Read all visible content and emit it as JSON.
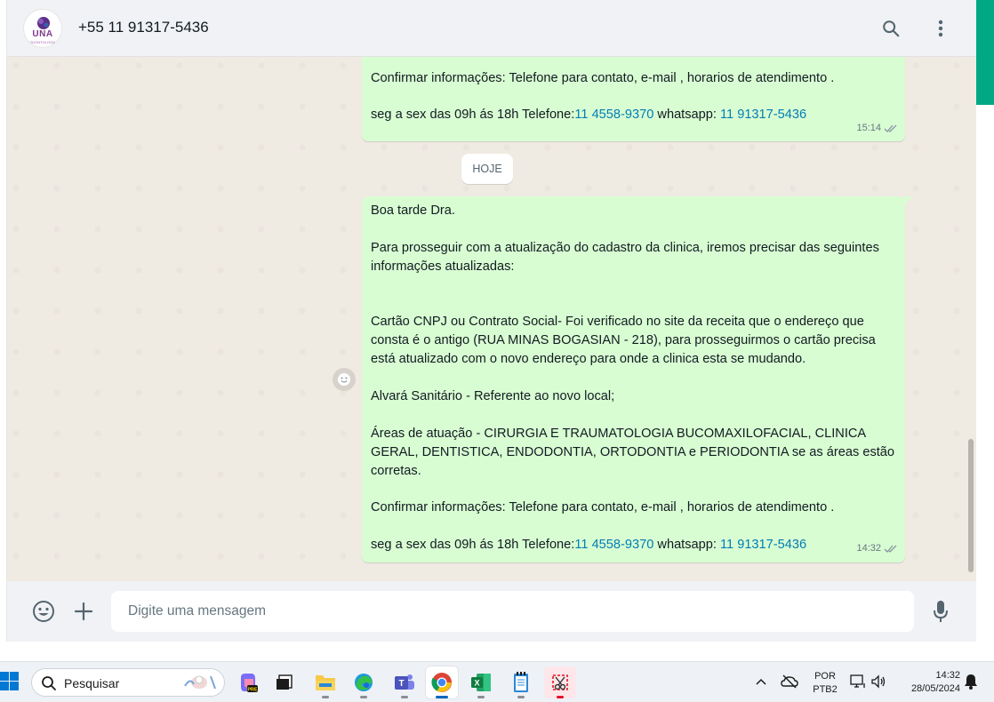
{
  "header": {
    "avatar_text": "UNA",
    "avatar_subtext": "ODONTOLOGIA",
    "contact_name": "+55 11 91317-5436",
    "search_icon": "search-icon",
    "menu_icon": "more-vertical-icon"
  },
  "chat": {
    "prev_message": {
      "line1": "Confirmar informações: Telefone para contato, e-mail , horarios de atendimento .",
      "line2_prefix": "seg a sex das 09h ás 18h Telefone:",
      "line2_phone": "11 4558-9370",
      "line2_mid": " whatsapp: ",
      "line2_whatsapp": "11 91317-5436",
      "time": "15:14"
    },
    "date_chip": "HOJE",
    "message": {
      "greeting": "Boa tarde Dra.",
      "intro": "Para prosseguir com a atualização do cadastro da clinica, iremos precisar das seguintes informações atualizadas:",
      "cnpj": "Cartão CNPJ ou Contrato Social- Foi verificado no site da receita que o endereço que consta é o antigo (RUA MINAS BOGASIAN - 218), para prosseguirmos o cartão precisa está atualizado com o novo endereço para onde a clinica esta se mudando.",
      "alvara": "Alvará Sanitário - Referente ao novo local;",
      "areas": "Áreas de atuação - CIRURGIA E TRAUMATOLOGIA BUCOMAXILOFACIAL, CLINICA GERAL, DENTISTICA, ENDODONTIA, ORTODONTIA e PERIODONTIA se as áreas estão corretas.",
      "confirm": "Confirmar informações: Telefone para contato, e-mail , horarios de atendimento .",
      "hours_prefix": "seg a sex das 09h ás 18h Telefone:",
      "hours_phone": "11 4558-9370",
      "hours_mid": " whatsapp: ",
      "hours_whatsapp": "11 91317-5436",
      "time": "14:32"
    },
    "status_icon": "double-check-icon"
  },
  "composer": {
    "emoji_icon": "emoji-icon",
    "attach_icon": "plus-icon",
    "placeholder": "Digite uma mensagem",
    "mic_icon": "microphone-icon"
  },
  "taskbar": {
    "search_placeholder": "Pesquisar",
    "apps": [
      "copilot-icon",
      "task-view-icon",
      "file-explorer-icon",
      "edge-icon",
      "teams-icon",
      "chrome-icon",
      "excel-icon",
      "notepad-icon",
      "snipping-tool-icon"
    ],
    "lang_line1": "POR",
    "lang_line2": "PTB2",
    "time": "14:32",
    "date": "28/05/2024"
  },
  "colors": {
    "accent": "#00a884",
    "outgoing_bubble": "#d9fdd3",
    "chat_bg": "#efeae2",
    "link": "#027eb5"
  }
}
